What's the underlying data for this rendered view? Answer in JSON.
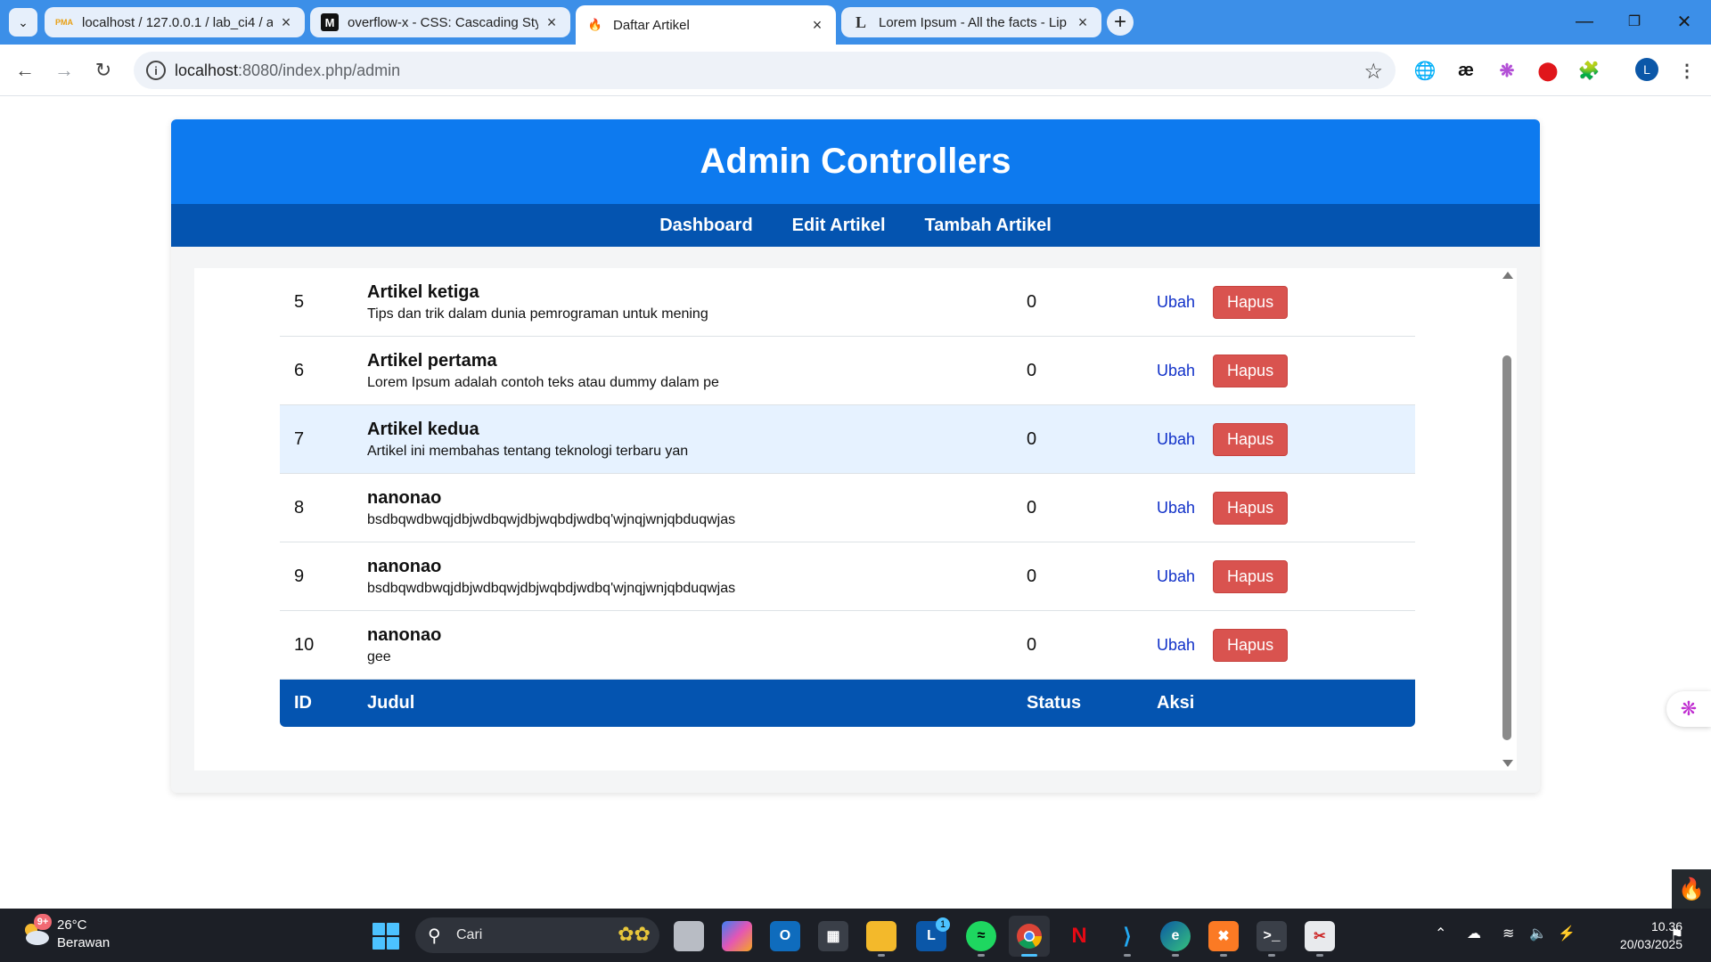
{
  "browser": {
    "tabs": [
      {
        "title": "localhost / 127.0.0.1 / lab_ci4 / a",
        "favicon": "PMA"
      },
      {
        "title": "overflow-x - CSS: Cascading Sty",
        "favicon": "M"
      },
      {
        "title": "Daftar Artikel",
        "favicon": "flame-icon"
      },
      {
        "title": "Lorem Ipsum - All the facts - Lip",
        "favicon": "L"
      }
    ],
    "url_host": "localhost",
    "url_path": ":8080/index.php/admin",
    "profile_initial": "L"
  },
  "page": {
    "header_title": "Admin Controllers",
    "nav": [
      "Dashboard",
      "Edit Artikel",
      "Tambah Artikel"
    ],
    "accent_color": "#0d7aef",
    "nav_color": "#0454b0",
    "rows": [
      {
        "id": "5",
        "title": "Artikel ketiga",
        "desc": "Tips dan trik dalam dunia pemrograman untuk mening",
        "status": "0",
        "edit": "Ubah",
        "delete": "Hapus"
      },
      {
        "id": "6",
        "title": "Artikel pertama",
        "desc": "Lorem Ipsum adalah contoh teks atau dummy dalam pe",
        "status": "0",
        "edit": "Ubah",
        "delete": "Hapus"
      },
      {
        "id": "7",
        "title": "Artikel kedua",
        "desc": "Artikel ini membahas tentang teknologi terbaru yan",
        "status": "0",
        "edit": "Ubah",
        "delete": "Hapus"
      },
      {
        "id": "8",
        "title": "nanonao",
        "desc": "bsdbqwdbwqjdbjwdbqwjdbjwqbdjwdbq'wjnqjwnjqbduqwjas",
        "status": "0",
        "edit": "Ubah",
        "delete": "Hapus"
      },
      {
        "id": "9",
        "title": "nanonao",
        "desc": "bsdbqwdbwqjdbjwdbqwjdbjwqbdjwdbq'wjnqjwnjqbduqwjas",
        "status": "0",
        "edit": "Ubah",
        "delete": "Hapus"
      },
      {
        "id": "10",
        "title": "nanonao",
        "desc": "gee",
        "status": "0",
        "edit": "Ubah",
        "delete": "Hapus"
      }
    ],
    "columns": {
      "id": "ID",
      "title": "Judul",
      "status": "Status",
      "action": "Aksi"
    }
  },
  "taskbar": {
    "weather_badge": "9+",
    "temperature": "26°C",
    "weather": "Berawan",
    "search_placeholder": "Cari",
    "mail_badge": "1",
    "time": "10.36",
    "date": "20/03/2025"
  }
}
